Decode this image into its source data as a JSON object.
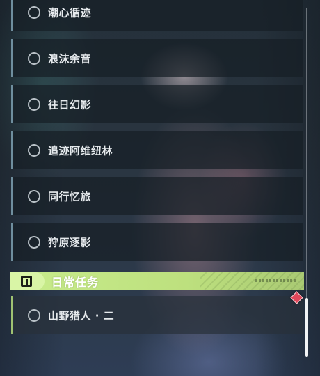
{
  "quests": [
    {
      "label": "潮心循迹"
    },
    {
      "label": "浪沫余音"
    },
    {
      "label": "往日幻影"
    },
    {
      "label": "追迹阿维纽林"
    },
    {
      "label": "同行忆旅"
    },
    {
      "label": "狩原逐影"
    }
  ],
  "daily_section": {
    "title": "日常任务",
    "quests": [
      {
        "label": "山野猎人 · 二"
      }
    ]
  },
  "icons": {
    "status": "empty-circle-icon",
    "section": "exclamation-icon",
    "marker": "red-diamond-icon"
  },
  "colors": {
    "accent_green": "#c8ec8c",
    "quest_border": "#6f8e9e",
    "daily_border": "#9fc272",
    "marker_red": "#e0475a"
  }
}
